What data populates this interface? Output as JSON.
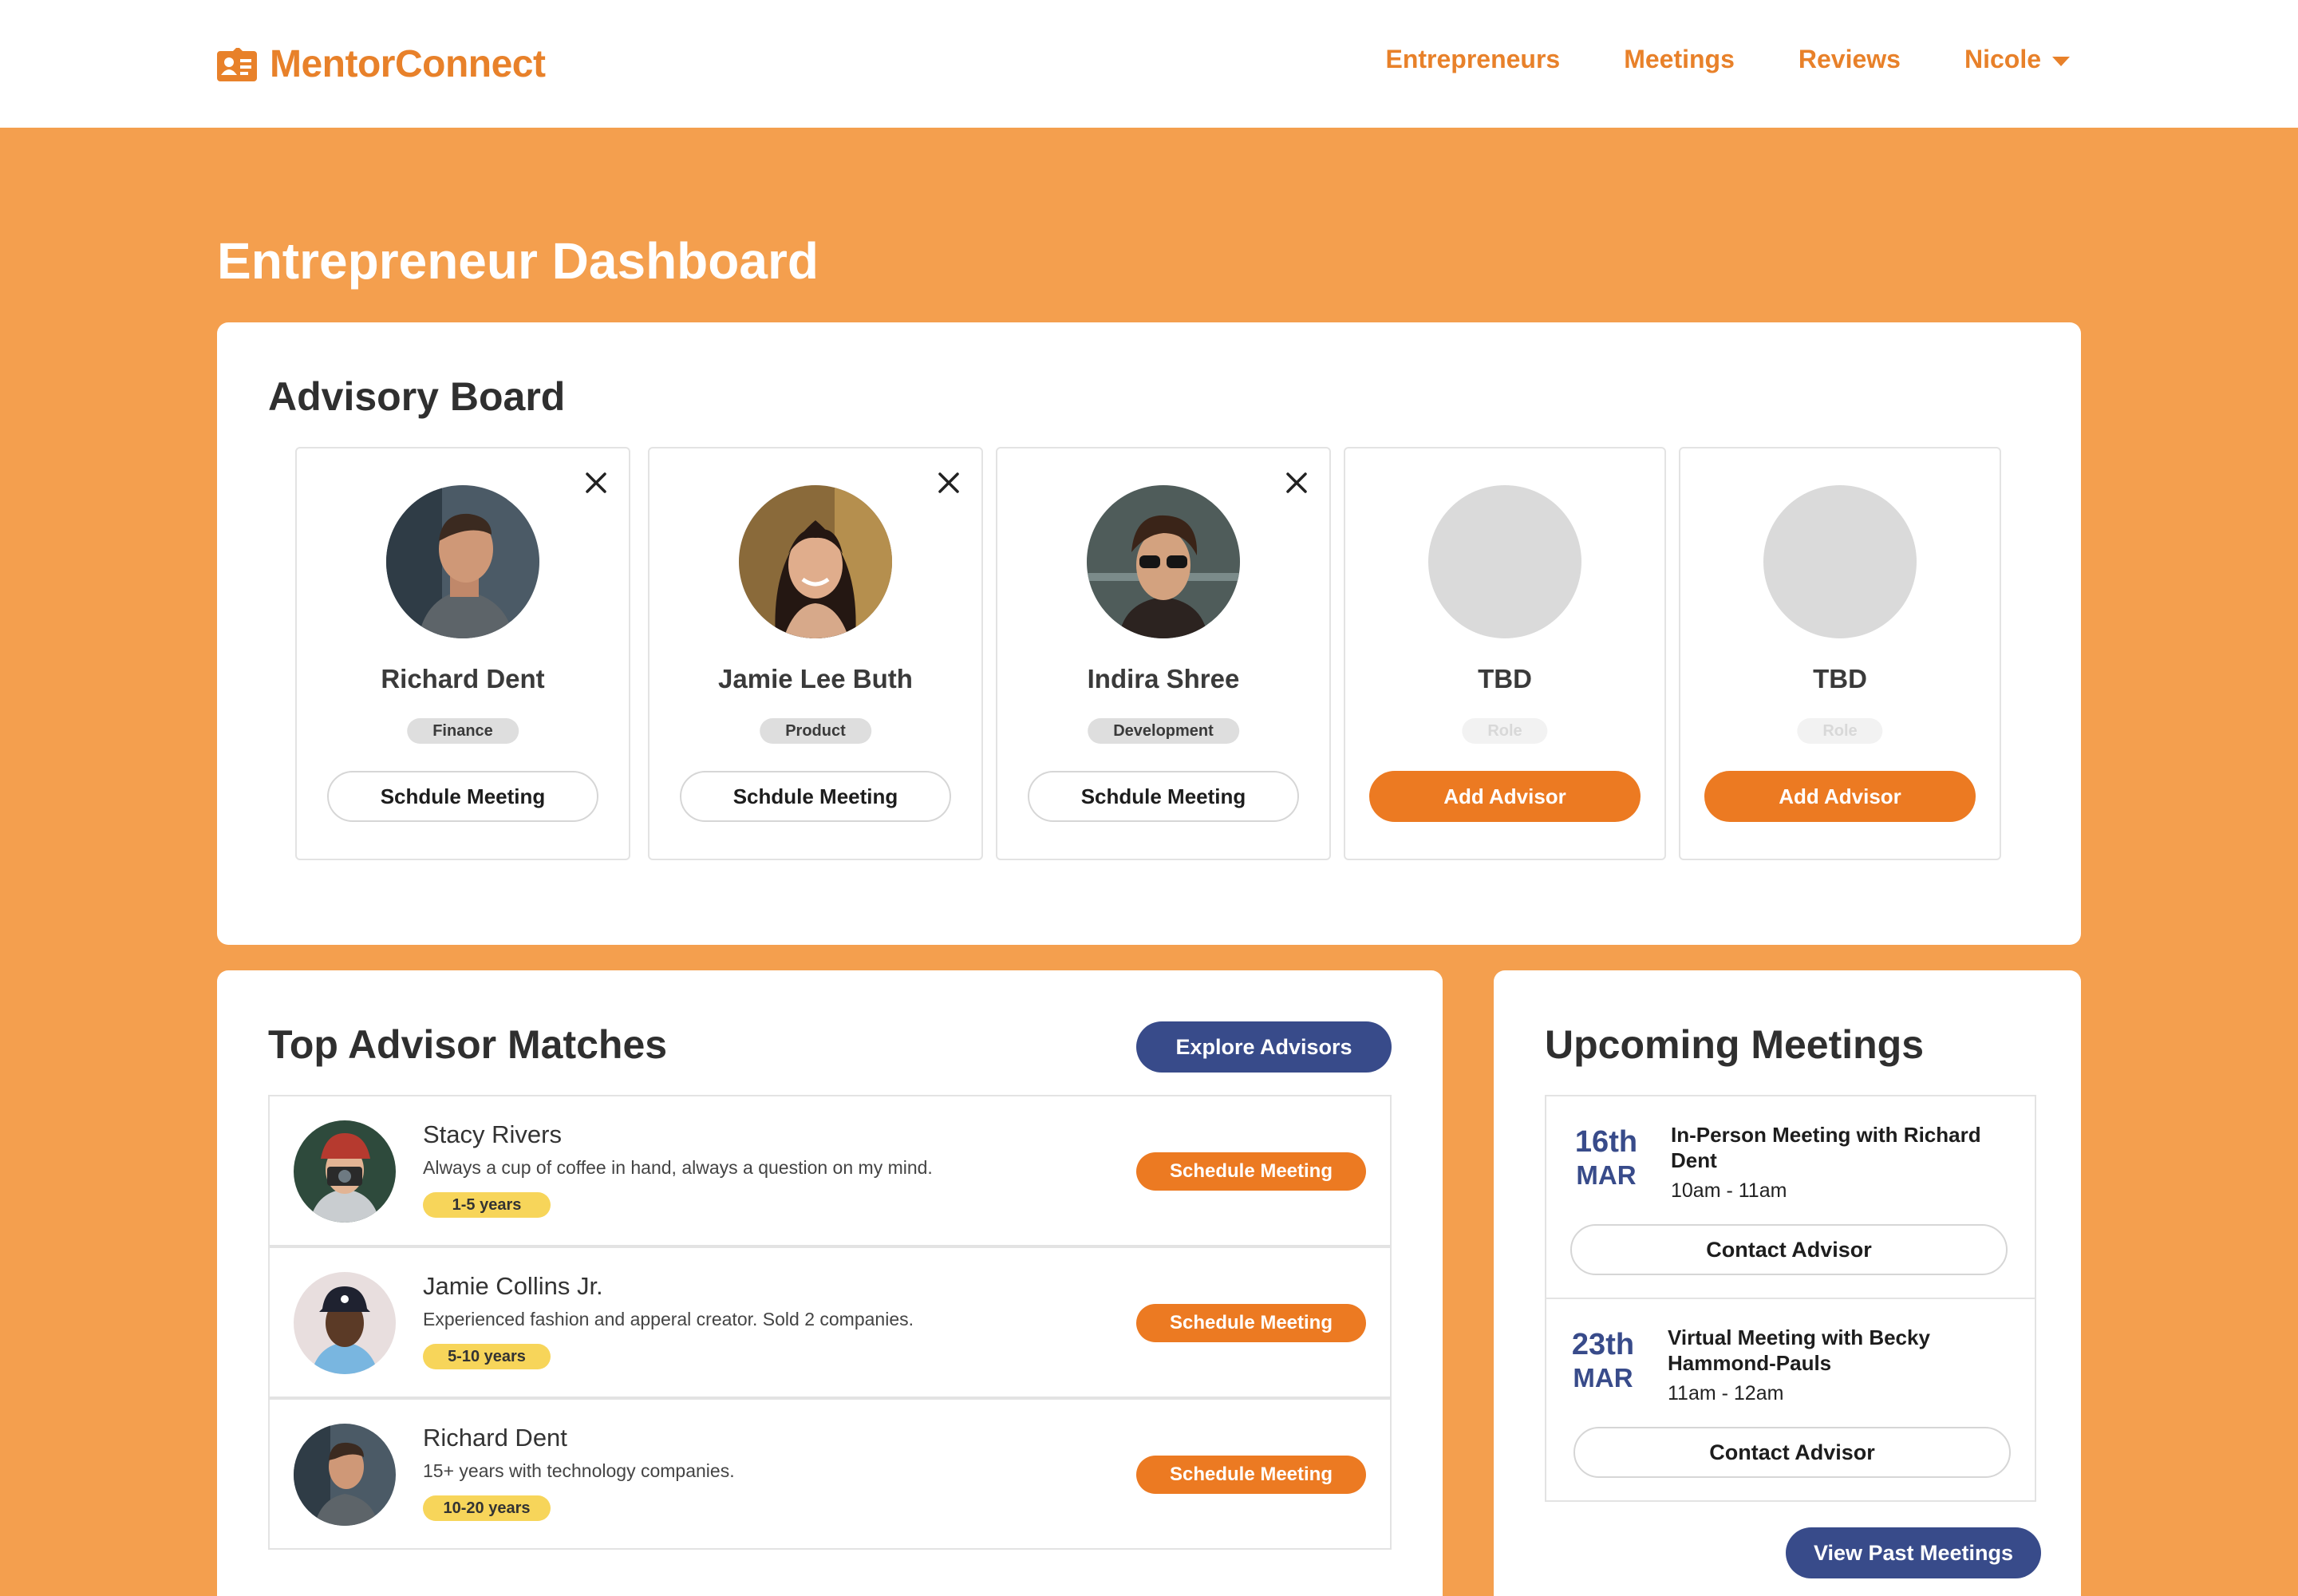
{
  "app": {
    "name": "MentorConnect",
    "logo_icon": "id-card-icon",
    "brand_color": "#e8812a"
  },
  "nav": {
    "items": [
      "Entrepreneurs",
      "Meetings",
      "Reviews"
    ],
    "user": "Nicole"
  },
  "page": {
    "title": "Entrepreneur Dashboard"
  },
  "advisory_board": {
    "title": "Advisory Board",
    "slots": [
      {
        "name": "Richard Dent",
        "role": "Finance",
        "button": "Schdule Meeting"
      },
      {
        "name": "Jamie Lee Buth",
        "role": "Product",
        "button": "Schdule Meeting"
      },
      {
        "name": "Indira Shree",
        "role": "Development",
        "button": "Schdule Meeting"
      },
      {
        "name": "TBD",
        "role": "Role",
        "button": "Add Advisor"
      },
      {
        "name": "TBD",
        "role": "Role",
        "button": "Add Advisor"
      }
    ]
  },
  "matches": {
    "title": "Top Advisor Matches",
    "explore_label": "Explore Advisors",
    "rows": [
      {
        "name": "Stacy Rivers",
        "desc": "Always a cup of coffee in hand, always a question on my mind.",
        "experience": "1-5 years",
        "button": "Schedule Meeting"
      },
      {
        "name": "Jamie Collins Jr.",
        "desc": "Experienced fashion and apperal creator. Sold 2 companies.",
        "experience": "5-10 years",
        "button": "Schedule Meeting"
      },
      {
        "name": "Richard Dent",
        "desc": "15+ years with technology companies.",
        "experience": "10-20 years",
        "button": "Schedule Meeting"
      }
    ]
  },
  "meetings": {
    "title": "Upcoming Meetings",
    "items": [
      {
        "day": "16th",
        "month": "MAR",
        "title": "In-Person Meeting with Richard Dent",
        "time": "10am - 11am",
        "button": "Contact Advisor"
      },
      {
        "day": "23th",
        "month": "MAR",
        "title": "Virtual Meeting with Becky Hammond-Pauls",
        "time": "11am - 12am",
        "button": "Contact Advisor"
      }
    ],
    "past_label": "View Past Meetings"
  },
  "colors": {
    "background": "#f49f4e",
    "orange_button": "#ec7a22",
    "navy": "#384b8a",
    "experience_pill": "#f7d55a"
  }
}
